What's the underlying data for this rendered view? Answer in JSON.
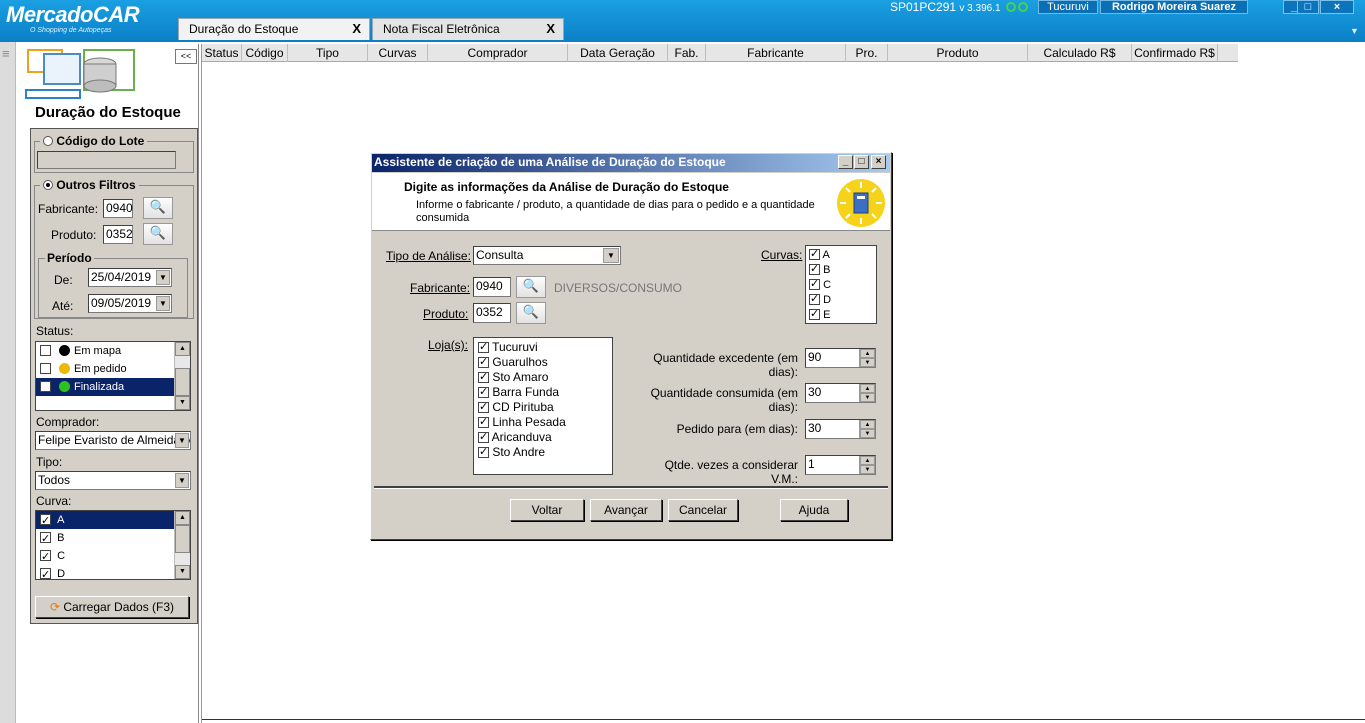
{
  "app": {
    "logo": "MercadoCAR",
    "logo_sub": "O Shopping de Autopeças",
    "tabs": [
      {
        "label": "Duração do Estoque",
        "close": "X"
      },
      {
        "label": "Nota Fiscal Eletrônica",
        "close": "X"
      }
    ],
    "host": "SP01PC291",
    "version": "v 3.396.1",
    "store": "Tucuruvi",
    "user": "Rodrigo Moreira Suarez",
    "win_min": "_",
    "win_max": "□",
    "win_close": "×"
  },
  "sidebar": {
    "collapse": "<<",
    "title": "Duração do Estoque",
    "lote_label": "Código do Lote",
    "lote_value": "",
    "outros_label": "Outros Filtros",
    "fabricante_label": "Fabricante:",
    "fabricante_value": "0940",
    "produto_label": "Produto:",
    "produto_value": "0352",
    "periodo_label": "Período",
    "de_label": "De:",
    "de_value": "25/04/2019",
    "ate_label": "Até:",
    "ate_value": "09/05/2019",
    "status_label": "Status:",
    "status_items": [
      {
        "label": "Em mapa",
        "color": "#000000",
        "checked": false
      },
      {
        "label": "Em pedido",
        "color": "#f0b800",
        "checked": false
      },
      {
        "label": "Finalizada",
        "color": "#2ec21c",
        "checked": false
      }
    ],
    "comprador_label": "Comprador:",
    "comprador_value": "Felipe Evaristo de Almeida M",
    "tipo_label": "Tipo:",
    "tipo_value": "Todos",
    "curva_label": "Curva:",
    "curva_items": [
      "A",
      "B",
      "C",
      "D"
    ],
    "load_button": "Carregar Dados (F3)"
  },
  "grid": {
    "columns": [
      "Status",
      "Código",
      "Tipo",
      "Curvas",
      "Comprador",
      "Data Geração",
      "Fab.",
      "Fabricante",
      "Pro.",
      "Produto",
      "Calculado R$",
      "Confirmado R$"
    ]
  },
  "dialog": {
    "title": "Assistente de criação de uma Análise de Duração do Estoque",
    "header_title": "Digite as informações da Análise de Duração do Estoque",
    "header_sub": "Informe o fabricante / produto, a quantidade de dias para o pedido e a quantidade consumida",
    "tipo_label": "Tipo de Análise:",
    "tipo_value": "Consulta",
    "fabricante_label": "Fabricante:",
    "fabricante_value": "0940",
    "fabricante_desc": "DIVERSOS/CONSUMO",
    "produto_label": "Produto:",
    "produto_value": "0352",
    "lojas_label": "Loja(s):",
    "lojas": [
      "Tucuruvi",
      "Guarulhos",
      "Sto Amaro",
      "Barra Funda",
      "CD Pirituba",
      "Linha Pesada",
      "Aricanduva",
      "Sto Andre"
    ],
    "curvas_label": "Curvas:",
    "curvas": [
      "A",
      "B",
      "C",
      "D",
      "E"
    ],
    "qtd_excedente_label": "Quantidade excedente (em dias):",
    "qtd_excedente_value": "90",
    "qtd_consumida_label": "Quantidade consumida (em dias):",
    "qtd_consumida_value": "30",
    "pedido_label": "Pedido para (em dias):",
    "pedido_value": "30",
    "vezes_label": "Qtde. vezes a considerar V.M.:",
    "vezes_value": "1",
    "btn_voltar": "Voltar",
    "btn_avancar": "Avançar",
    "btn_cancelar": "Cancelar",
    "btn_ajuda": "Ajuda"
  }
}
